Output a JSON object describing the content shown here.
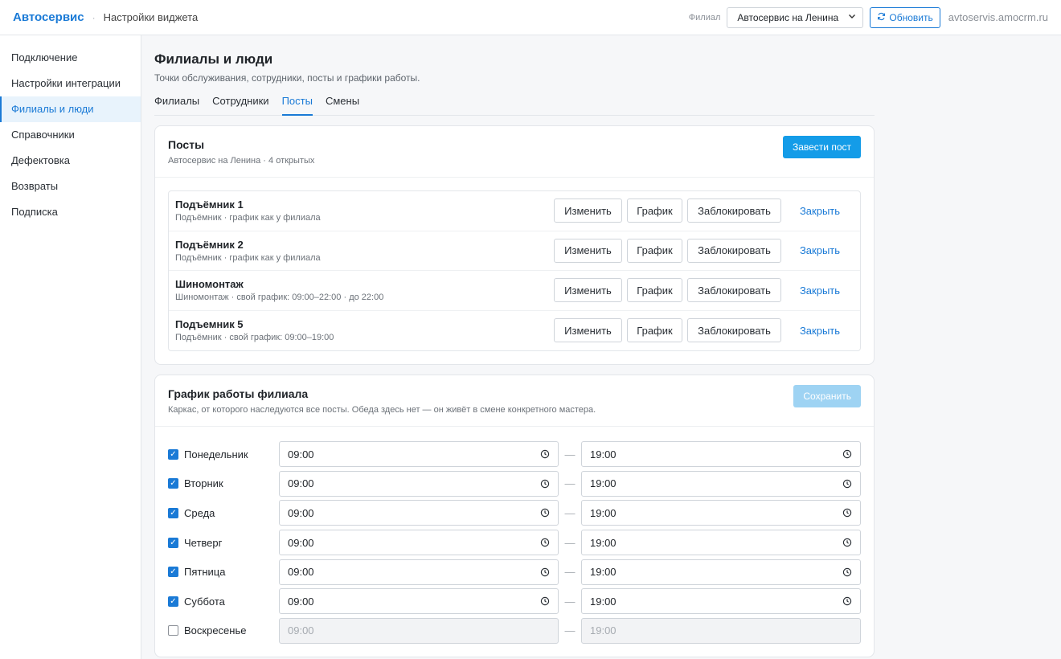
{
  "header": {
    "brand": "Автосервис",
    "separator": "·",
    "subtitle": "Настройки виджета",
    "branch_label": "Филиал",
    "branch_selected": "Автосервис на Ленина",
    "refresh_label": "Обновить",
    "domain": "avtoservis.amocrm.ru"
  },
  "sidebar": {
    "items": [
      {
        "label": "Подключение"
      },
      {
        "label": "Настройки интеграции"
      },
      {
        "label": "Филиалы и люди"
      },
      {
        "label": "Справочники"
      },
      {
        "label": "Дефектовка"
      },
      {
        "label": "Возвраты"
      },
      {
        "label": "Подписка"
      }
    ],
    "active": "Филиалы и люди"
  },
  "page": {
    "title": "Филиалы и люди",
    "subtitle": "Точки обслуживания, сотрудники, посты и графики работы.",
    "tabs": [
      {
        "label": "Филиалы"
      },
      {
        "label": "Сотрудники"
      },
      {
        "label": "Посты"
      },
      {
        "label": "Смены"
      }
    ],
    "active_tab": "Посты"
  },
  "posts": {
    "title": "Посты",
    "subtitle": "Автосервис на Ленина · 4 открытых",
    "add_label": "Завести пост",
    "action_edit": "Изменить",
    "action_schedule": "График",
    "action_block": "Заблокировать",
    "action_close": "Закрыть",
    "items": [
      {
        "name": "Подъёмник 1",
        "desc": "Подъёмник · график как у филиала"
      },
      {
        "name": "Подъёмник 2",
        "desc": "Подъёмник · график как у филиала"
      },
      {
        "name": "Шиномонтаж",
        "desc": "Шиномонтаж · свой график: 09:00–22:00 · до 22:00"
      },
      {
        "name": "Подъемник 5",
        "desc": "Подъёмник · свой график: 09:00–19:00"
      }
    ]
  },
  "schedule": {
    "title": "График работы филиала",
    "subtitle": "Каркас, от которого наследуются все посты. Обеда здесь нет — он живёт в смене конкретного мастера.",
    "save_label": "Сохранить",
    "dash": "—",
    "days": [
      {
        "label": "Понедельник",
        "enabled": true,
        "from": "09:00",
        "to": "19:00"
      },
      {
        "label": "Вторник",
        "enabled": true,
        "from": "09:00",
        "to": "19:00"
      },
      {
        "label": "Среда",
        "enabled": true,
        "from": "09:00",
        "to": "19:00"
      },
      {
        "label": "Четверг",
        "enabled": true,
        "from": "09:00",
        "to": "19:00"
      },
      {
        "label": "Пятница",
        "enabled": true,
        "from": "09:00",
        "to": "19:00"
      },
      {
        "label": "Суббота",
        "enabled": true,
        "from": "09:00",
        "to": "19:00"
      },
      {
        "label": "Воскресенье",
        "enabled": false,
        "from": "09:00",
        "to": "19:00"
      }
    ]
  },
  "colors": {
    "accent": "#1a7ad6",
    "primary_button": "#149ce8"
  }
}
